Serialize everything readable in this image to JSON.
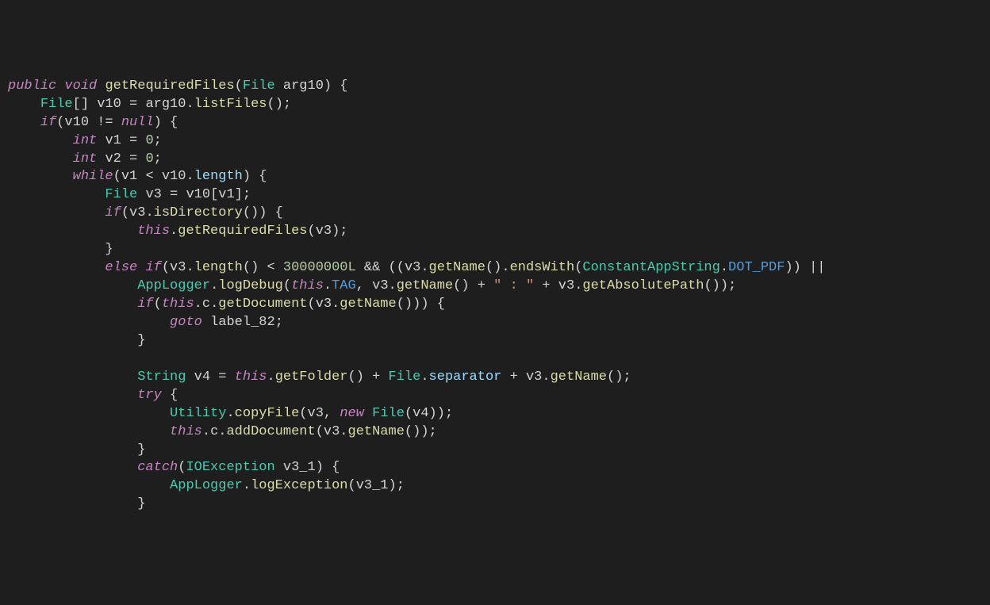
{
  "code": {
    "l1": {
      "kw1": "public",
      "kw2": "void",
      "fn": "getRequiredFiles",
      "type": "File",
      "param": "arg10"
    },
    "l2": {
      "type": "File",
      "arr": "[]",
      "var": "v10",
      "assign": "arg10",
      "method": "listFiles"
    },
    "l3": {
      "kw": "if",
      "var": "v10",
      "op": "!=",
      "val": "null"
    },
    "l4": {
      "kw": "int",
      "var": "v1",
      "val": "0"
    },
    "l5": {
      "kw": "int",
      "var": "v2",
      "val": "0"
    },
    "l6": {
      "kw": "while",
      "var": "v1",
      "op": "<",
      "obj": "v10",
      "prop": "length"
    },
    "l7": {
      "type": "File",
      "var": "v3",
      "obj": "v10",
      "idx": "v1"
    },
    "l8": {
      "kw": "if",
      "obj": "v3",
      "method": "isDirectory"
    },
    "l9": {
      "kw": "this",
      "method": "getRequiredFiles",
      "arg": "v3"
    },
    "l10": {},
    "l11": {
      "kw1": "else",
      "kw2": "if",
      "obj": "v3",
      "m1": "length",
      "op": "<",
      "num": "30000000L",
      "obj2": "v3",
      "m2": "getName",
      "m3": "endsWith",
      "cls": "ConstantAppString",
      "prop": "DOT_PDF",
      "or": "||"
    },
    "l12": {
      "cls": "AppLogger",
      "m1": "logDebug",
      "kw": "this",
      "prop": "TAG",
      "obj": "v3",
      "m2": "getName",
      "str": "\" : \"",
      "obj2": "v3",
      "m3": "getAbsolutePath"
    },
    "l13": {
      "kw": "if",
      "kw2": "this",
      "prop": "c",
      "m1": "getDocument",
      "obj": "v3",
      "m2": "getName"
    },
    "l14": {
      "kw": "goto",
      "label": "label_82"
    },
    "l15": {},
    "l16": {},
    "l17": {
      "type": "String",
      "var": "v4",
      "kw": "this",
      "m1": "getFolder",
      "cls": "File",
      "prop": "separator",
      "obj": "v3",
      "m2": "getName"
    },
    "l18": {
      "kw": "try"
    },
    "l19": {
      "cls": "Utility",
      "m1": "copyFile",
      "arg1": "v3",
      "kw": "new",
      "cls2": "File",
      "arg2": "v4"
    },
    "l20": {
      "kw": "this",
      "prop": "c",
      "m1": "addDocument",
      "obj": "v3",
      "m2": "getName"
    },
    "l21": {},
    "l22": {
      "kw": "catch",
      "type": "IOException",
      "var": "v3_1"
    },
    "l23": {
      "cls": "AppLogger",
      "m1": "logException",
      "arg": "v3_1"
    },
    "l24": {}
  }
}
